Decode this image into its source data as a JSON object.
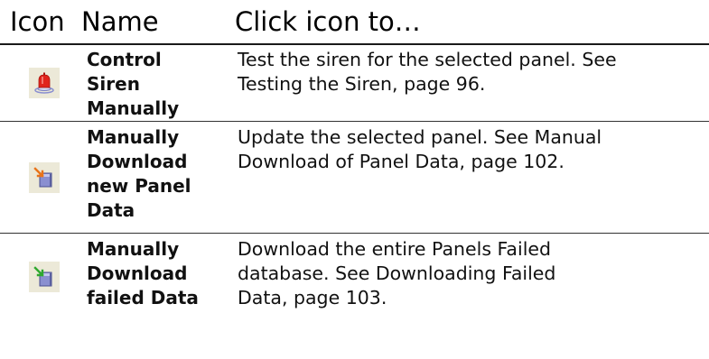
{
  "header": {
    "icon": "Icon",
    "name": "Name",
    "action": "Click icon to…"
  },
  "rows": [
    {
      "icon": "siren-bell-icon",
      "name_lines": [
        "Control",
        "Siren",
        "Manually"
      ],
      "desc_lines": [
        "Test the siren for the selected panel. See",
        "Testing the Siren, page 96."
      ]
    },
    {
      "icon": "download-panel-data-icon",
      "name_lines": [
        "Manually",
        "Download",
        "new Panel",
        "Data"
      ],
      "desc_lines": [
        "Update the selected panel. See Manual",
        "Download of Panel Data, page 102."
      ]
    },
    {
      "icon": "download-failed-data-icon",
      "name_lines": [
        "Manually",
        "Download",
        "failed Data"
      ],
      "desc_lines": [
        "Download the entire Panels Failed",
        "database. See Downloading Failed",
        "Data, page 103."
      ]
    }
  ],
  "colors": {
    "siren_red": "#e0241c",
    "arrow_orange": "#e8731a",
    "arrow_green": "#2fa82f",
    "panel_blue": "#8a8fd0",
    "icon_bg": "#ece9d8"
  }
}
